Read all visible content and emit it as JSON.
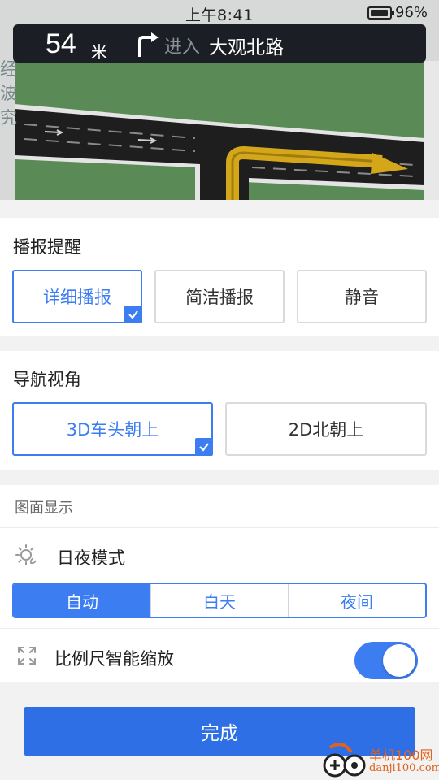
{
  "status_bar": {
    "time": "上午8:41",
    "battery_pct": "96%",
    "battery_level": 0.96
  },
  "map": {
    "side_text": "经波究"
  },
  "guidance": {
    "distance": "54",
    "unit": "米",
    "turn_direction": "right",
    "enter_label": "进入",
    "road_name": "大观北路"
  },
  "broadcast": {
    "title": "播报提醒",
    "options": [
      "详细播报",
      "简洁播报",
      "静音"
    ],
    "selected_index": 0
  },
  "view_angle": {
    "title": "导航视角",
    "options": [
      "3D车头朝上",
      "2D北朝上"
    ],
    "selected_index": 0
  },
  "display": {
    "section_label": "图面显示",
    "day_night": {
      "label": "日夜模式",
      "icon": "sun-moon-icon",
      "options": [
        "自动",
        "白天",
        "夜间"
      ],
      "selected_index": 0
    },
    "scale_zoom": {
      "label": "比例尺智能缩放",
      "icon": "expand-icon",
      "enabled": true
    }
  },
  "done_label": "完成",
  "watermark": {
    "line1": "单机100网",
    "line2": "danji100.com"
  },
  "colors": {
    "accent": "#3c7df2",
    "button": "#2f6fe6",
    "map_green": "#5a8a55",
    "road_yellow": "#d4a71a"
  }
}
